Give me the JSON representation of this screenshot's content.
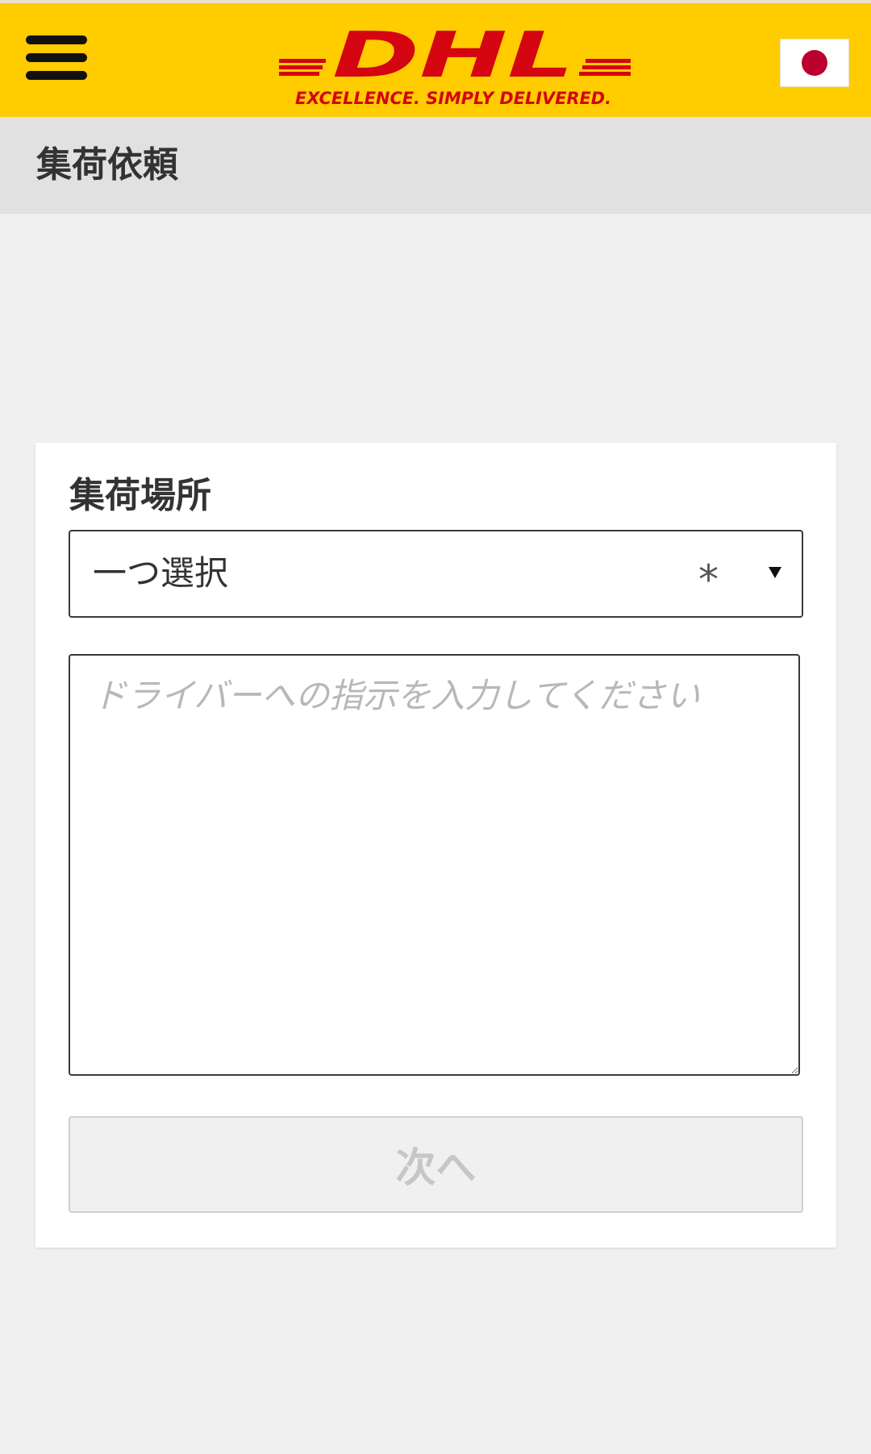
{
  "header": {
    "brand": {
      "name": "DHL",
      "tagline": "EXCELLENCE. SIMPLY DELIVERED.",
      "wordmark_color": "#d40511",
      "background_color": "#ffcc00"
    },
    "menu_icon": "hamburger-menu-icon",
    "language_flag": {
      "icon": "japan-flag-icon",
      "disc_color": "#bc002d"
    }
  },
  "page": {
    "title": "集荷依頼"
  },
  "form": {
    "pickup_location": {
      "label": "集荷場所",
      "selected_value": "一つ選択",
      "required_mark": "*"
    },
    "driver_instructions": {
      "value": "",
      "placeholder": "ドライバーへの指示を入力してください"
    },
    "next_button": {
      "label": "次へ",
      "disabled": true
    }
  }
}
